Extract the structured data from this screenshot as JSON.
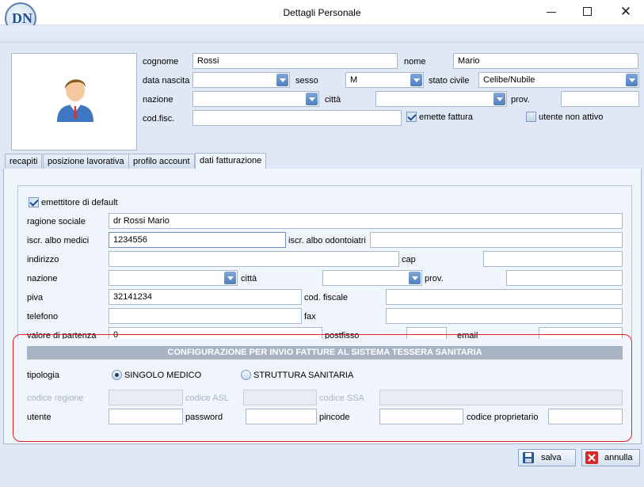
{
  "window": {
    "title": "Dettagli Personale",
    "logo": "DN"
  },
  "header": {
    "cognome_label": "cognome",
    "cognome_value": "Rossi",
    "nome_label": "nome",
    "nome_value": "Mario",
    "data_nascita_label": "data nascita",
    "data_nascita_value": "",
    "sesso_label": "sesso",
    "sesso_value": "M",
    "stato_civile_label": "stato civile",
    "stato_civile_value": "Celibe/Nubile",
    "nazione_label": "nazione",
    "nazione_value": "",
    "citta_label": "città",
    "citta_value": "",
    "prov_label": "prov.",
    "prov_value": "",
    "codfisc_label": "cod.fisc.",
    "codfisc_value": "",
    "emette_fattura_label": "emette fattura",
    "emette_fattura_checked": true,
    "non_attivo_label": "utente non attivo",
    "non_attivo_checked": false
  },
  "tabs": [
    {
      "label": "recapiti"
    },
    {
      "label": "posizione lavorativa"
    },
    {
      "label": "profilo account"
    },
    {
      "label": "dati fatturazione",
      "active": true
    }
  ],
  "billing": {
    "default_label": "emettitore di default",
    "default_checked": true,
    "ragione_label": "ragione sociale",
    "ragione_value": "dr Rossi Mario",
    "albo_medici_label": "iscr. albo medici",
    "albo_medici_value": "1234556",
    "albo_odonto_label": "iscr. albo odontoiatri",
    "albo_odonto_value": "",
    "indirizzo_label": "indirizzo",
    "indirizzo_value": "",
    "cap_label": "cap",
    "cap_value": "",
    "nazione_label": "nazione",
    "nazione_value": "",
    "citta_label": "città",
    "citta_value": "",
    "prov_label": "prov.",
    "prov_value": "",
    "piva_label": "piva",
    "piva_value": "32141234",
    "codfiscale_label": "cod. fiscale",
    "codfiscale_value": "",
    "telefono_label": "telefono",
    "telefono_value": "",
    "fax_label": "fax",
    "fax_value": "",
    "valore_label": "valore di partenza",
    "valore_value": "0",
    "postfisso_label": "postfisso",
    "postfisso_value": "",
    "email_label": "email",
    "email_value": ""
  },
  "ts": {
    "heading": "CONFIGURAZIONE PER INVIO FATTURE AL SISTEMA TESSERA SANITARIA",
    "tipologia_label": "tipologia",
    "opt_singolo": "SINGOLO MEDICO",
    "opt_struttura": "STRUTTURA SANITARIA",
    "selected": "SINGOLO MEDICO",
    "codice_regione_label": "codice regione",
    "codice_asl_label": "codice ASL",
    "codice_ssa_label": "codice SSA",
    "utente_label": "utente",
    "utente_value": "",
    "password_label": "password",
    "password_value": "",
    "pincode_label": "pincode",
    "pincode_value": "",
    "proprietario_label": "codice proprietario",
    "proprietario_value": ""
  },
  "footer": {
    "salva_label": "salva",
    "annulla_label": "annulla"
  },
  "colors": {
    "accent": "#2a5694",
    "highlight": "#e02020",
    "ts_heading_bg": "#a8b4c4",
    "window_bg": "#dfe8f4"
  },
  "icons": {
    "avatar": "user-avatar-icon",
    "salva": "floppy-disk-icon",
    "annulla": "close-icon"
  }
}
